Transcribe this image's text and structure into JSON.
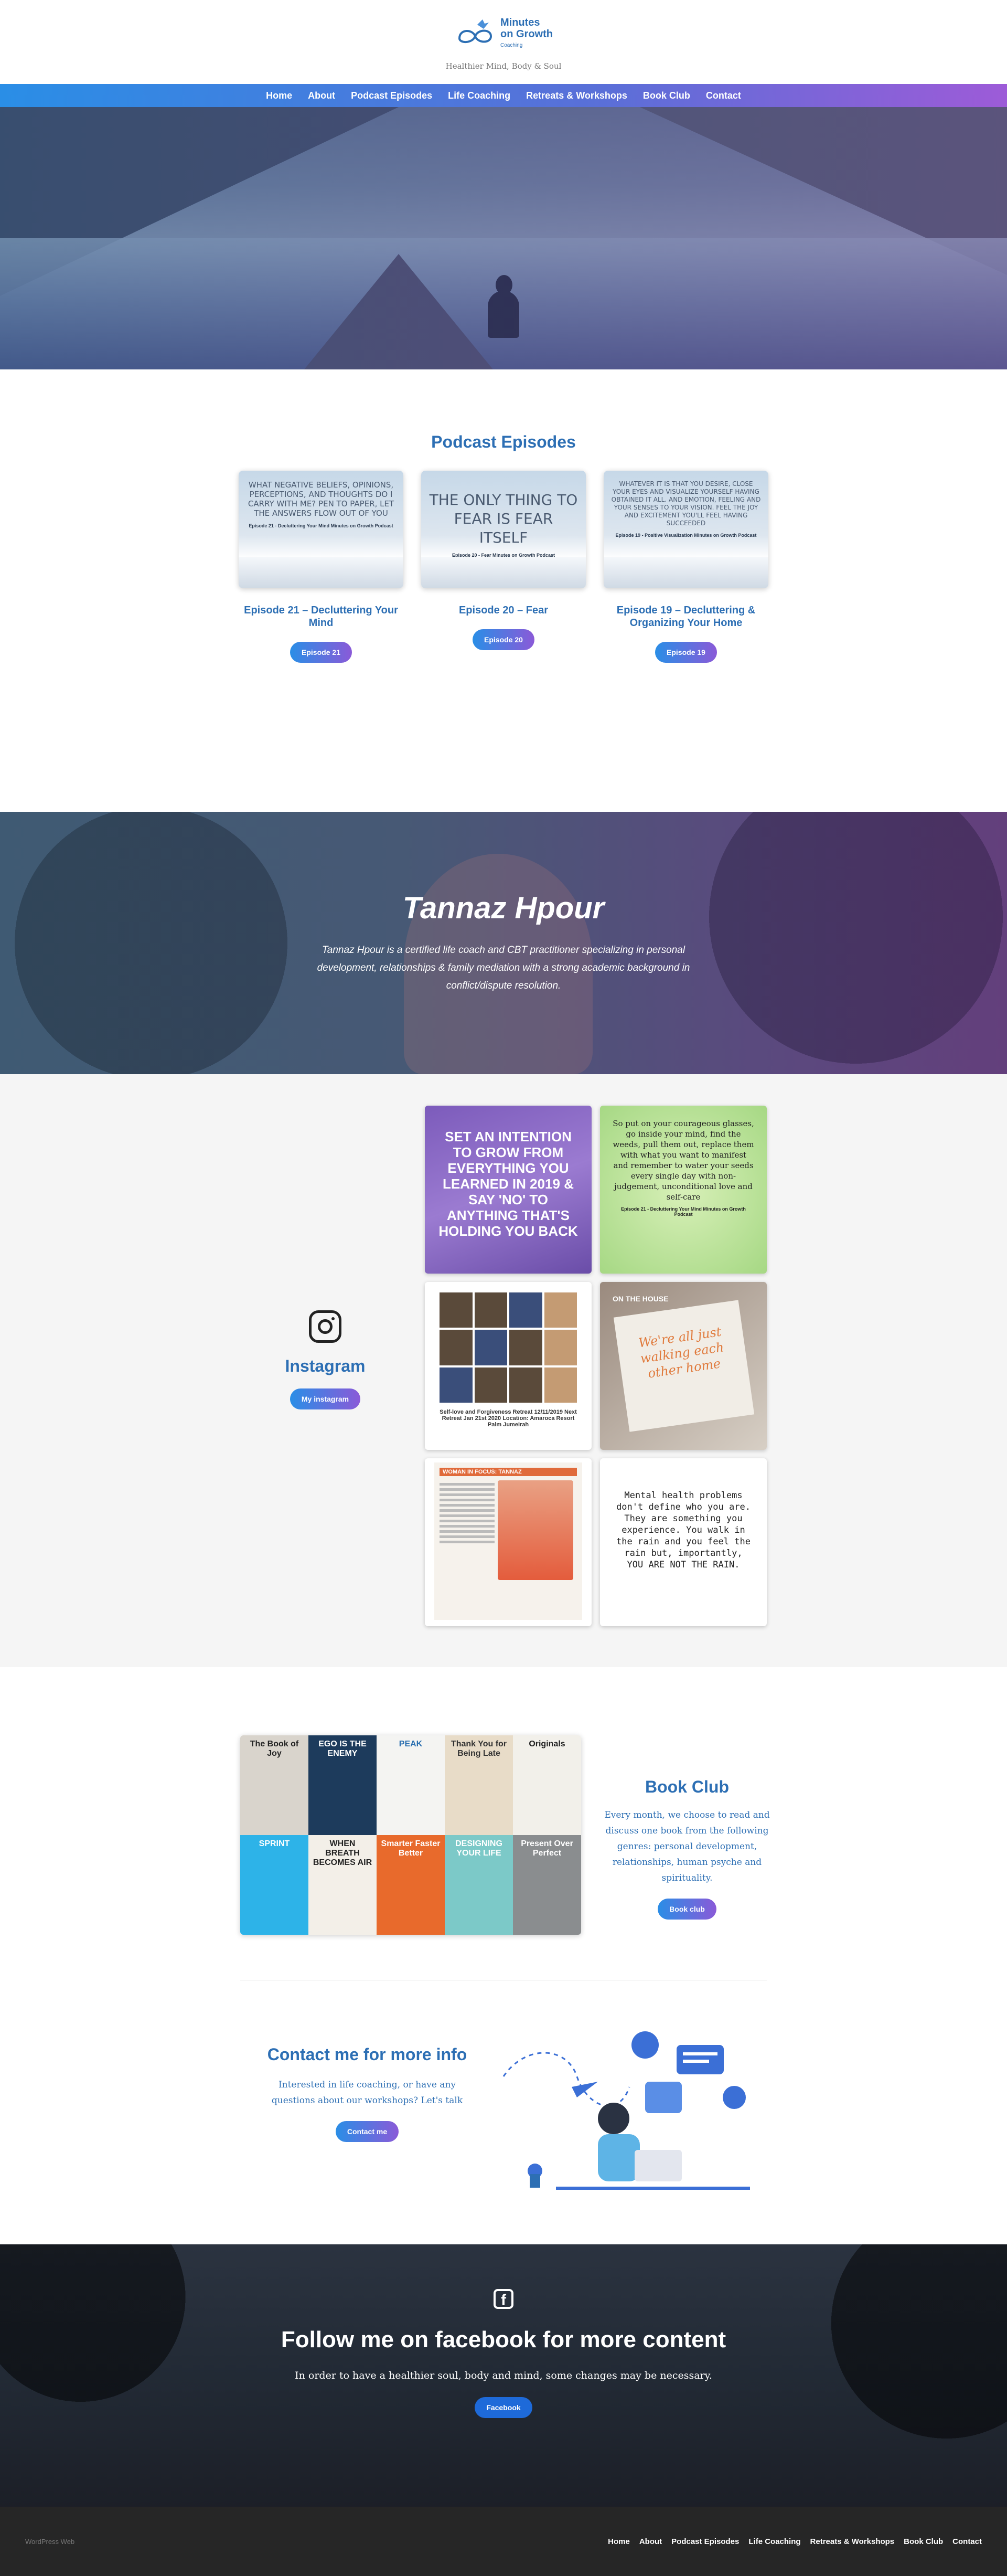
{
  "header": {
    "logo_text_line1": "Minutes",
    "logo_text_line2": "on Growth",
    "logo_text_small": "Coaching",
    "tagline": "Healthier Mind, Body & Soul"
  },
  "nav": {
    "items": [
      "Home",
      "About",
      "Podcast Episodes",
      "Life Coaching",
      "Retreats & Workshops",
      "Book Club",
      "Contact"
    ]
  },
  "podcast": {
    "title": "Podcast Episodes",
    "episodes": [
      {
        "quote": "What negative beliefs, opinions, perceptions, and thoughts do I carry with me? Pen to paper, let the answers flow out of you",
        "sub": "Episode 21 - Decluttering Your Mind\nMinutes on Growth Podcast",
        "title": "Episode 21 – Decluttering Your Mind",
        "button": "Episode 21"
      },
      {
        "quote": "The only thing to fear is fear itself",
        "sub": "Episode 20 - Fear\nMinutes on Growth Podcast",
        "title": "Episode 20 – Fear",
        "button": "Episode 20"
      },
      {
        "quote": "Whatever it is that you desire, close your eyes and visualize yourself having obtained it all. And emotion, feeling and your senses to your vision. Feel the joy and excitement you'll feel having succeeded",
        "sub": "Episode 19 - Positive Visualization\nMinutes on Growth Podcast",
        "title": "Episode 19 – Decluttering & Organizing Your Home",
        "button": "Episode 19"
      }
    ]
  },
  "about": {
    "name": "Tannaz Hpour",
    "bio": "Tannaz Hpour is a certified life coach and CBT practitioner specializing in personal development, relationships & family mediation with a strong academic background in conflict/dispute resolution."
  },
  "instagram": {
    "title": "Instagram",
    "button": "My instagram",
    "posts": {
      "p1": "Set an intention to grow from everything you learned in 2019 & say 'no' to anything that's holding you back",
      "p2": "So put on your courageous glasses, go inside your mind, find the weeds, pull them out, replace them with what you want to manifest and remember to water your seeds every single day with non-judgement, unconditional love and self-care",
      "p2_sub": "Episode 21 - Decluttering Your Mind\nMinutes on Growth Podcast",
      "p3_caption": "Self-love and Forgiveness Retreat 12/11/2019\nNext Retreat Jan 21st 2020\nLocation: Amaroca Resort Palm Jumeirah",
      "p4_sign": "We're all just walking each other home",
      "p4_top": "ON THE HOUSE",
      "p5_header": "WOMAN IN FOCUS: TANNAZ",
      "p6": "Mental health problems don't define who you are. They are something you experience. You walk in the rain and you feel the rain but, importantly, YOU ARE NOT THE RAIN."
    }
  },
  "bookclub": {
    "title": "Book Club",
    "text": "Every month, we choose to read and discuss one book from the following genres: personal development, relationships, human psyche and spirituality.",
    "button": "Book club",
    "books": [
      {
        "title": "The Book of Joy",
        "color": "#d9d4cc",
        "text_color": "#222"
      },
      {
        "title": "EGO IS THE ENEMY",
        "color": "#1d3b5c",
        "text_color": "#fff"
      },
      {
        "title": "PEAK",
        "color": "#f4f4f2",
        "text_color": "#2a6fb0"
      },
      {
        "title": "Thank You for Being Late",
        "color": "#e8dcc8",
        "text_color": "#333"
      },
      {
        "title": "Originals",
        "color": "#f2f0ea",
        "text_color": "#222"
      },
      {
        "title": "SPRINT",
        "color": "#2db3e8",
        "text_color": "#fff"
      },
      {
        "title": "WHEN BREATH BECOMES AIR",
        "color": "#f3efe8",
        "text_color": "#222"
      },
      {
        "title": "Smarter Faster Better",
        "color": "#e86a2c",
        "text_color": "#fff"
      },
      {
        "title": "DESIGNING YOUR LIFE",
        "color": "#7cc9c8",
        "text_color": "#fff"
      },
      {
        "title": "Present Over Perfect",
        "color": "#8a8d8f",
        "text_color": "#fff"
      }
    ]
  },
  "contact": {
    "title": "Contact me for more info",
    "text": "Interested in life coaching, or have any questions about our workshops? Let's talk",
    "button": "Contact me"
  },
  "facebook": {
    "title": "Follow me on facebook for more content",
    "text": "In order to have a healthier soul, body and mind, some changes may be necessary.",
    "button": "Facebook"
  },
  "footer": {
    "copyright": "WordPress Web",
    "items": [
      "Home",
      "About",
      "Podcast Episodes",
      "Life Coaching",
      "Retreats & Workshops",
      "Book Club",
      "Contact"
    ]
  },
  "colors": {
    "brand_blue": "#2d6fb4",
    "gradient_start": "#2a8ee6",
    "gradient_end": "#9d5bd8",
    "facebook_blue": "#1e6ad9"
  }
}
